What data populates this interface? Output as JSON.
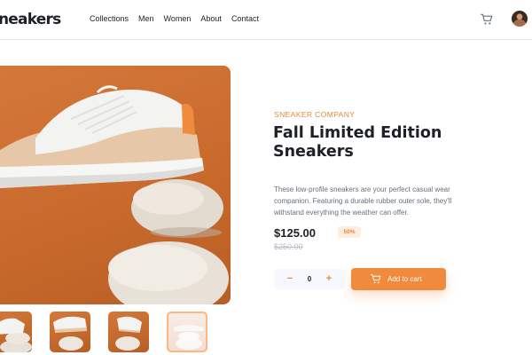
{
  "header": {
    "logo": "neakers",
    "nav": [
      "Collections",
      "Men",
      "Women",
      "About",
      "Contact"
    ],
    "cart_icon": "cart-icon",
    "avatar_icon": "user-avatar"
  },
  "product": {
    "company": "Sneaker Company",
    "title": "Fall Limited Edition Sneakers",
    "description": "These low-profile sneakers are your perfect casual wear companion. Featuring a durable rubber outer sole, they'll withstand everything the weather can offer.",
    "price": "$125.00",
    "discount": "50%",
    "original_price": "$250.00"
  },
  "cart_controls": {
    "minus_label": "−",
    "quantity": "0",
    "plus_label": "+",
    "add_to_cart_label": "Add to cart"
  },
  "gallery": {
    "selected_index": 3,
    "thumbnail_count": 4
  },
  "colors": {
    "accent": "#ff7d1a",
    "accent_text": "#e2893a",
    "discount_bg": "#ffede0",
    "text_dark": "#1d2026",
    "text_muted": "#68707d"
  }
}
